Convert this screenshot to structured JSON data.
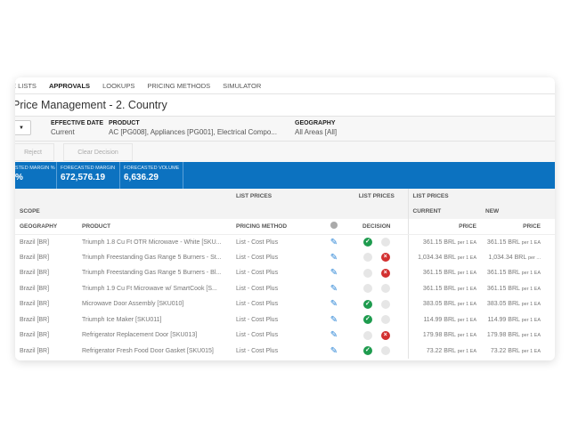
{
  "nav": [
    "E LISTS",
    "APPROVALS",
    "LOOKUPS",
    "PRICING METHODS",
    "SIMULATOR"
  ],
  "nav_active": 1,
  "title": "Price Management - 2. Country",
  "filters": {
    "effective_date_label": "EFFECTIVE DATE",
    "effective_date": "Current",
    "product_label": "PRODUCT",
    "product": "AC [PG008], Appliances [PG001], Electrical Compo...",
    "geography_label": "GEOGRAPHY",
    "geography": "All Areas [All]"
  },
  "buttons": {
    "reject": "Reject",
    "clear": "Clear Decision"
  },
  "kpis": [
    {
      "label": "STED MARGIN %",
      "value": "%"
    },
    {
      "label": "FORECASTED MARGIN",
      "value": "672,576.19"
    },
    {
      "label": "FORECASTED VOLUME",
      "value": "6,636.29"
    }
  ],
  "headers": {
    "list_prices": "LIST PRICES",
    "scope": "SCOPE",
    "current": "CURRENT",
    "new": "NEW",
    "geography": "GEOGRAPHY",
    "product": "PRODUCT",
    "pricing_method": "PRICING METHOD",
    "decision": "DECISION",
    "price": "PRICE"
  },
  "colors": {
    "accent": "#0c72c0",
    "approve": "#1e9b4e",
    "reject": "#d23030"
  },
  "rows": [
    {
      "geo": "Brazil [BR]",
      "product": "Triumph 1.8 Cu Ft OTR Microwave - White [SKU...",
      "method": "List - Cost Plus",
      "decision": "approved",
      "current": "361.15 BRL",
      "current_per": "per 1 EA",
      "new": "361.15 BRL",
      "new_per": "per 1 EA"
    },
    {
      "geo": "Brazil [BR]",
      "product": "Triumph Freestanding Gas Range 5 Burners - St...",
      "method": "List - Cost Plus",
      "decision": "rejected",
      "current": "1,034.34 BRL",
      "current_per": "per 1 EA",
      "new": "1,034.34 BRL",
      "new_per": "per ..."
    },
    {
      "geo": "Brazil [BR]",
      "product": "Triumph Freestanding Gas Range 5 Burners - Bl...",
      "method": "List - Cost Plus",
      "decision": "rejected",
      "current": "361.15 BRL",
      "current_per": "per 1 EA",
      "new": "361.15 BRL",
      "new_per": "per 1 EA"
    },
    {
      "geo": "Brazil [BR]",
      "product": "Triumph 1.9 Cu Ft Microwave w/ SmartCook [S...",
      "method": "List - Cost Plus",
      "decision": "none",
      "current": "361.15 BRL",
      "current_per": "per 1 EA",
      "new": "361.15 BRL",
      "new_per": "per 1 EA"
    },
    {
      "geo": "Brazil [BR]",
      "product": "Microwave Door Assembly [SKU010]",
      "method": "List - Cost Plus",
      "decision": "approved",
      "current": "383.05 BRL",
      "current_per": "per 1 EA",
      "new": "383.05 BRL",
      "new_per": "per 1 EA"
    },
    {
      "geo": "Brazil [BR]",
      "product": "Triumph Ice Maker [SKU011]",
      "method": "List - Cost Plus",
      "decision": "approved",
      "current": "114.99 BRL",
      "current_per": "per 1 EA",
      "new": "114.99 BRL",
      "new_per": "per 1 EA"
    },
    {
      "geo": "Brazil [BR]",
      "product": "Refrigerator Replacement Door [SKU013]",
      "method": "List - Cost Plus",
      "decision": "rejected",
      "current": "179.98 BRL",
      "current_per": "per 1 EA",
      "new": "179.98 BRL",
      "new_per": "per 1 EA"
    },
    {
      "geo": "Brazil [BR]",
      "product": "Refrigerator Fresh Food Door Gasket [SKU015]",
      "method": "List - Cost Plus",
      "decision": "approved",
      "current": "73.22 BRL",
      "current_per": "per 1 EA",
      "new": "73.22 BRL",
      "new_per": "per 1 EA"
    }
  ]
}
